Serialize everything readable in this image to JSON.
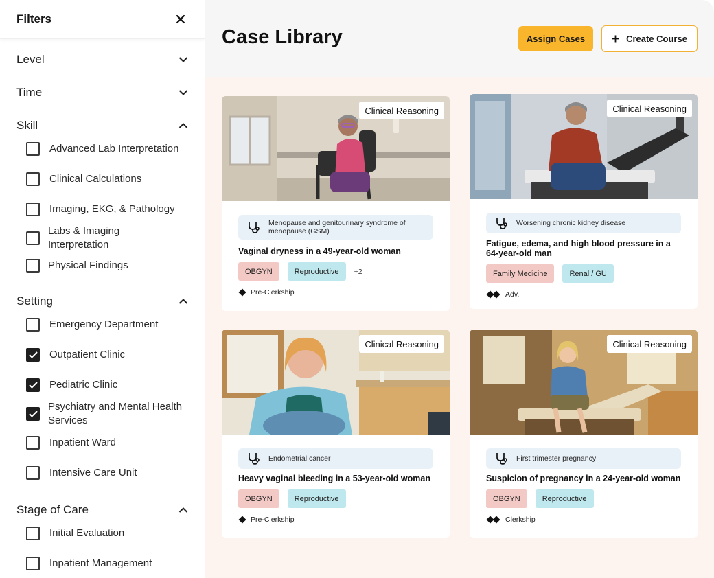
{
  "sidebar": {
    "title": "Filters",
    "sections": {
      "level": {
        "title": "Level"
      },
      "time": {
        "title": "Time"
      },
      "skill": {
        "title": "Skill",
        "options": [
          {
            "label": "Advanced Lab Interpretation",
            "checked": false
          },
          {
            "label": "Clinical Calculations",
            "checked": false
          },
          {
            "label": "Imaging, EKG, & Pathology",
            "checked": false
          },
          {
            "label": "Labs & Imaging Interpretation",
            "checked": false
          },
          {
            "label": "Physical Findings",
            "checked": false
          }
        ]
      },
      "setting": {
        "title": "Setting",
        "options": [
          {
            "label": "Emergency Department",
            "checked": false
          },
          {
            "label": "Outpatient Clinic",
            "checked": true
          },
          {
            "label": "Pediatric Clinic",
            "checked": true
          },
          {
            "label": "Psychiatry and Mental Health Services",
            "checked": true
          },
          {
            "label": "Inpatient Ward",
            "checked": false
          },
          {
            "label": "Intensive Care Unit",
            "checked": false
          }
        ]
      },
      "stage": {
        "title": "Stage of Care",
        "options": [
          {
            "label": "Initial Evaluation",
            "checked": false
          },
          {
            "label": "Inpatient Management",
            "checked": false
          }
        ]
      }
    }
  },
  "main": {
    "title": "Case Library",
    "assign_label": "Assign Cases",
    "create_label": "Create Course",
    "cards": [
      {
        "type_tag": "Clinical Reasoning",
        "diagnosis": "Menopause and genitourinary syndrome of menopause (GSM)",
        "title": "Vaginal dryness in a 49-year-old woman",
        "specialty": "OBGYN",
        "system": "Reproductive",
        "more": "+2",
        "level": "Pre-Clerkship"
      },
      {
        "type_tag": "Clinical Reasoning",
        "diagnosis": "Worsening chronic kidney disease",
        "title": "Fatigue, edema, and high blood pressure in a 64-year-old man",
        "specialty": "Family Medicine",
        "system": "Renal / GU",
        "level": "Adv."
      },
      {
        "type_tag": "Clinical Reasoning",
        "diagnosis": "Endometrial cancer",
        "title": "Heavy vaginal bleeding in a 53-year-old woman",
        "specialty": "OBGYN",
        "system": "Reproductive",
        "level": "Pre-Clerkship"
      },
      {
        "type_tag": "Clinical Reasoning",
        "diagnosis": "First trimester pregnancy",
        "title": "Suspicion of pregnancy in a 24-year-old woman",
        "specialty": "OBGYN",
        "system": "Reproductive",
        "level": "Clerkship"
      }
    ]
  },
  "colors": {
    "accent": "#f9b52c",
    "specialty_chip": "#f2c9c4",
    "system_chip": "#bfe8ee",
    "diagnosis_bg": "#e8f0f8",
    "grid_bg": "#fdf4ef"
  }
}
